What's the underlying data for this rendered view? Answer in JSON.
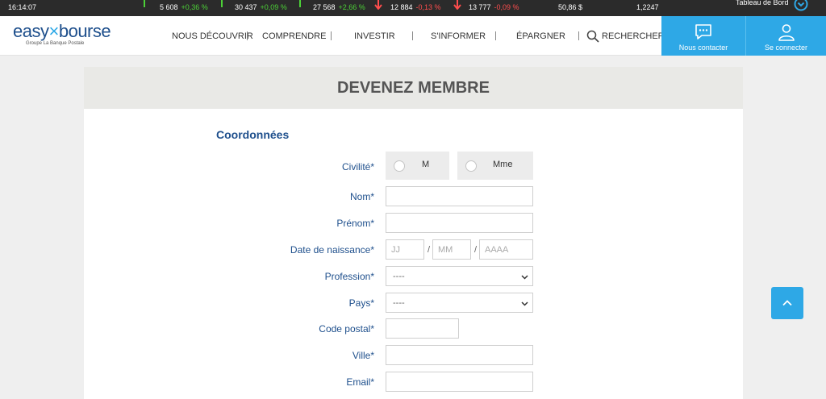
{
  "ticker": {
    "time": "16:14:07",
    "items": [
      {
        "value": "5 608",
        "change": "+0,36 %",
        "direction": "up"
      },
      {
        "value": "30 437",
        "change": "+0,09 %",
        "direction": "up"
      },
      {
        "value": "27 568",
        "change": "+2,66 %",
        "direction": "up"
      },
      {
        "value": "12 884",
        "change": "-0,13 %",
        "direction": "down"
      },
      {
        "value": "13 777",
        "change": "-0,09 %",
        "direction": "down"
      },
      {
        "value": "50,86 $",
        "change": "",
        "direction": "none"
      },
      {
        "value": "1,2247",
        "change": "",
        "direction": "none"
      }
    ],
    "dashboard_label": "Tableau de Bord"
  },
  "brand": {
    "logo_part1": "easy",
    "logo_part2": "bourse",
    "tagline": "Groupe La Banque Postale",
    "accent_color": "#2ea8e6",
    "primary_color": "#1e4f8c"
  },
  "nav": {
    "items": [
      "NOUS DÉCOUVRIR",
      "COMPRENDRE",
      "INVESTIR",
      "S'INFORMER",
      "ÉPARGNER"
    ],
    "search_label": "RECHERCHER",
    "contact_label": "Nous contacter",
    "login_label": "Se connecter"
  },
  "page": {
    "title": "DEVENEZ MEMBRE",
    "section_title": "Coordonnées"
  },
  "form": {
    "civilite_label": "Civilité*",
    "civilite_options": [
      "M",
      "Mme"
    ],
    "nom_label": "Nom*",
    "prenom_label": "Prénom*",
    "birth_label": "Date de naissance*",
    "birth_day_placeholder": "JJ",
    "birth_month_placeholder": "MM",
    "birth_year_placeholder": "AAAA",
    "birth_separator": "/",
    "profession_label": "Profession*",
    "profession_value": "----",
    "pays_label": "Pays*",
    "pays_value": "----",
    "postal_label": "Code postal*",
    "ville_label": "Ville*",
    "email_label": "Email*"
  }
}
